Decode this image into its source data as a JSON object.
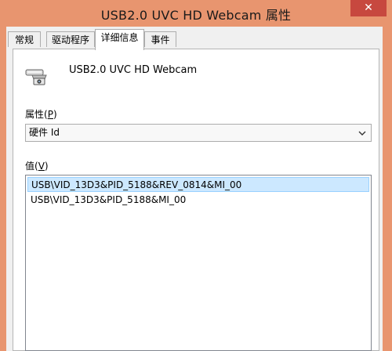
{
  "window": {
    "title": "USB2.0 UVC HD Webcam 属性",
    "close_label": "✕"
  },
  "tabs": [
    {
      "label": "常规",
      "active": false
    },
    {
      "label": "驱动程序",
      "active": false
    },
    {
      "label": "详细信息",
      "active": true
    },
    {
      "label": "事件",
      "active": false
    }
  ],
  "device": {
    "name": "USB2.0 UVC HD Webcam",
    "icon": "webcam-icon"
  },
  "property": {
    "label_prefix": "属性(",
    "label_key": "P",
    "label_suffix": ")",
    "selected": "硬件 Id"
  },
  "value": {
    "label_prefix": "值(",
    "label_key": "V",
    "label_suffix": ")",
    "items": [
      {
        "text": "USB\\VID_13D3&PID_5188&REV_0814&MI_00",
        "selected": true
      },
      {
        "text": "USB\\VID_13D3&PID_5188&MI_00",
        "selected": false
      }
    ]
  },
  "colors": {
    "titlebar": "#e8956f",
    "close_button": "#c7483f",
    "selection": "#cce8ff"
  }
}
